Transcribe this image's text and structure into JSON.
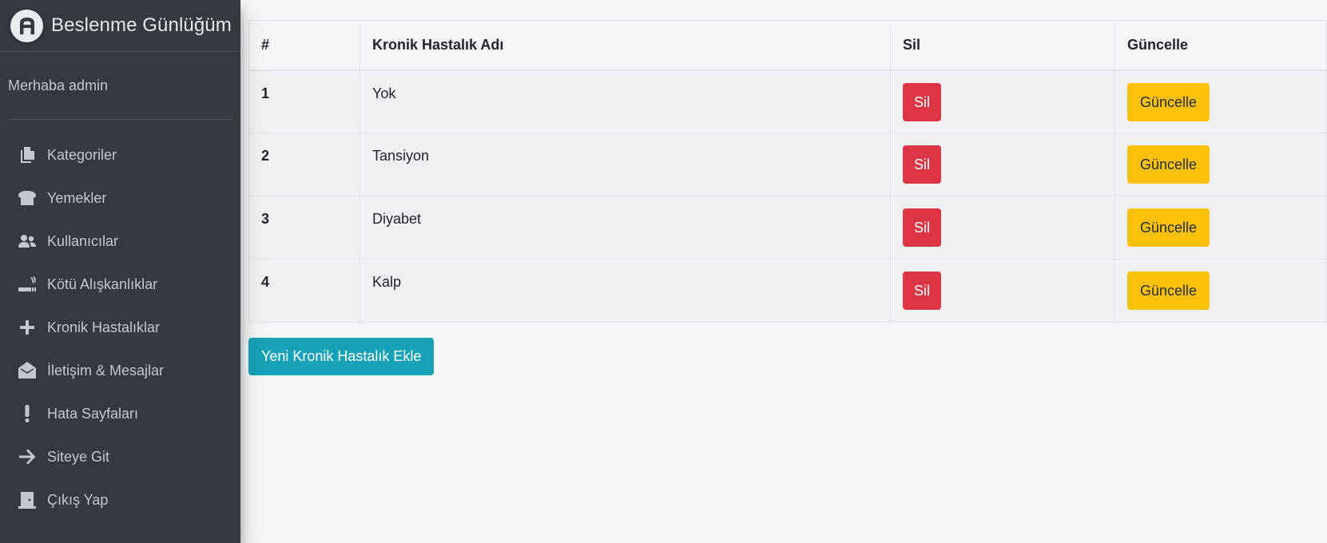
{
  "brand": {
    "title": "Beslenme Günlüğüm",
    "logo_icon": "a-logo-icon"
  },
  "user": {
    "greeting": "Merhaba admin"
  },
  "sidebar": {
    "items": [
      {
        "label": "Kategoriler",
        "icon": "copy-icon"
      },
      {
        "label": "Yemekler",
        "icon": "bread-icon"
      },
      {
        "label": "Kullanıcılar",
        "icon": "users-icon"
      },
      {
        "label": "Kötü Alışkanlıklar",
        "icon": "smoking-icon"
      },
      {
        "label": "Kronik Hastalıklar",
        "icon": "plus-icon"
      },
      {
        "label": "İletişim & Mesajlar",
        "icon": "envelope-open-icon"
      },
      {
        "label": "Hata Sayfaları",
        "icon": "exclamation-icon"
      },
      {
        "label": "Siteye Git",
        "icon": "arrow-right-icon"
      },
      {
        "label": "Çıkış Yap",
        "icon": "door-icon"
      }
    ]
  },
  "table": {
    "headers": {
      "num": "#",
      "name": "Kronik Hastalık Adı",
      "delete": "Sil",
      "update": "Güncelle"
    },
    "rows": [
      {
        "num": "1",
        "name": "Yok",
        "delete_label": "Sil",
        "update_label": "Güncelle"
      },
      {
        "num": "2",
        "name": "Tansiyon",
        "delete_label": "Sil",
        "update_label": "Güncelle"
      },
      {
        "num": "3",
        "name": "Diyabet",
        "delete_label": "Sil",
        "update_label": "Güncelle"
      },
      {
        "num": "4",
        "name": "Kalp",
        "delete_label": "Sil",
        "update_label": "Güncelle"
      }
    ]
  },
  "actions": {
    "add_label": "Yeni Kronik Hastalık Ekle"
  },
  "colors": {
    "sidebar_bg": "#343a40",
    "danger": "#dc3545",
    "warning": "#ffc107",
    "info": "#17a2b8",
    "page_bg": "#f4f6f9"
  }
}
